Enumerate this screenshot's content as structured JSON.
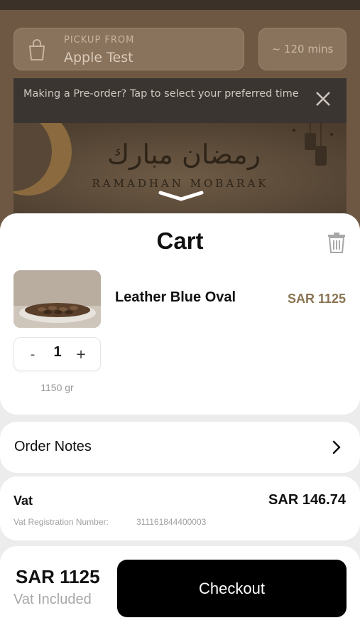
{
  "header": {
    "pickup_label": "PICKUP FROM",
    "pickup_location": "Apple Test",
    "eta": "~ 120 mins"
  },
  "preorder_banner": {
    "text": "Making a Pre-order? Tap to select your preferred time"
  },
  "promo_banner": {
    "arabic_text": "رمضان مبارك",
    "latin_text": "RAMADHAN MOBARAK"
  },
  "cart": {
    "title": "Cart",
    "items": [
      {
        "name": "Leather Blue Oval",
        "price": "SAR 1125",
        "quantity": "1",
        "weight": "1150 gr",
        "minus_label": "-",
        "plus_label": "+"
      }
    ]
  },
  "order_notes": {
    "label": "Order Notes"
  },
  "vat": {
    "label": "Vat",
    "amount": "SAR 146.74",
    "registration_label": "Vat Registration Number:",
    "registration_number": "311161844400003"
  },
  "footer": {
    "total": "SAR 1125",
    "total_note": "Vat Included",
    "checkout_label": "Checkout"
  },
  "colors": {
    "accent_price": "#8a7452",
    "checkout_bg": "#000000",
    "sheet_bg": "#ececec"
  }
}
